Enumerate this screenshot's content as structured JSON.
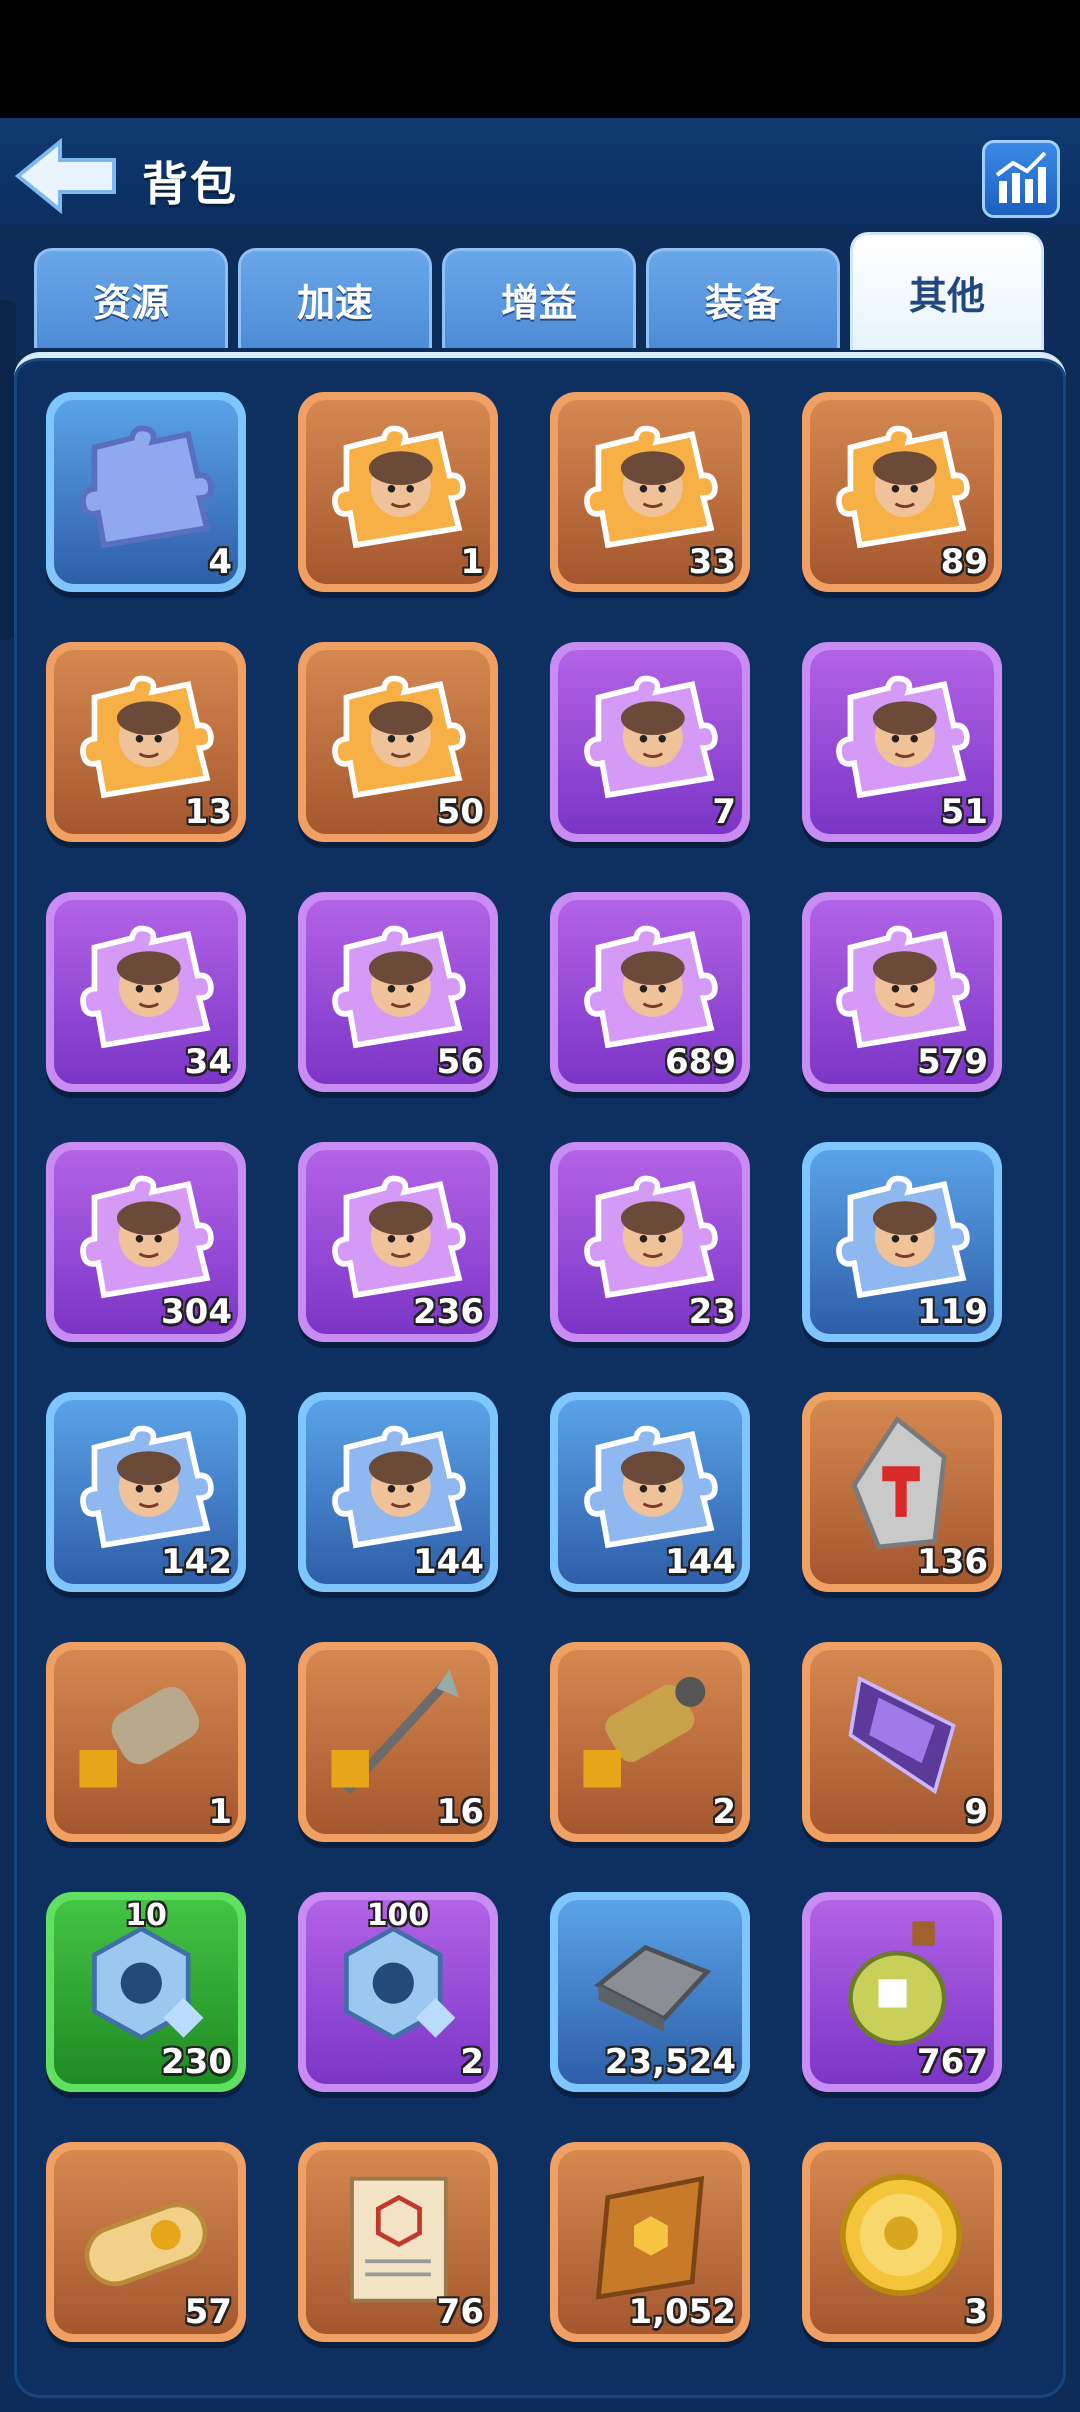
{
  "header": {
    "title": "背包"
  },
  "tabs": [
    {
      "label": "资源",
      "active": false
    },
    {
      "label": "加速",
      "active": false
    },
    {
      "label": "增益",
      "active": false
    },
    {
      "label": "装备",
      "active": false
    },
    {
      "label": "其他",
      "active": true
    }
  ],
  "items": [
    {
      "icon": "blank-puzzle-piece-icon",
      "rarity": "blue",
      "count": "4"
    },
    {
      "icon": "hero-puzzle-hooded-icon",
      "rarity": "orange",
      "count": "1"
    },
    {
      "icon": "hero-puzzle-knight-icon",
      "rarity": "orange",
      "count": "33"
    },
    {
      "icon": "hero-puzzle-bearded-elder-icon",
      "rarity": "orange",
      "count": "89"
    },
    {
      "icon": "hero-puzzle-plague-doctor-icon",
      "rarity": "orange",
      "count": "13"
    },
    {
      "icon": "hero-puzzle-goggles-girl-icon",
      "rarity": "orange",
      "count": "50"
    },
    {
      "icon": "hero-puzzle-headlamp-miner-icon",
      "rarity": "purple",
      "count": "7"
    },
    {
      "icon": "hero-puzzle-bandolier-icon",
      "rarity": "purple",
      "count": "51"
    },
    {
      "icon": "hero-puzzle-dark-haired-woman-icon",
      "rarity": "purple",
      "count": "34"
    },
    {
      "icon": "hero-puzzle-red-haired-woman-icon",
      "rarity": "purple",
      "count": "56"
    },
    {
      "icon": "hero-puzzle-bearded-chief-icon",
      "rarity": "purple",
      "count": "689"
    },
    {
      "icon": "hero-puzzle-aviator-icon",
      "rarity": "purple",
      "count": "579"
    },
    {
      "icon": "hero-puzzle-red-hat-dwarf-icon",
      "rarity": "purple",
      "count": "304"
    },
    {
      "icon": "hero-puzzle-officer-icon",
      "rarity": "purple",
      "count": "236"
    },
    {
      "icon": "hero-puzzle-grey-haired-woman-icon",
      "rarity": "purple",
      "count": "23"
    },
    {
      "icon": "hero-puzzle-blonde-hero-icon",
      "rarity": "blue",
      "count": "119"
    },
    {
      "icon": "hero-puzzle-cap-mustache-icon",
      "rarity": "blue",
      "count": "142"
    },
    {
      "icon": "hero-puzzle-goggles-dwarf-icon",
      "rarity": "blue",
      "count": "144"
    },
    {
      "icon": "hero-puzzle-soldier-icon",
      "rarity": "blue",
      "count": "144"
    },
    {
      "icon": "forge-stone-icon",
      "rarity": "orange",
      "count": "136"
    },
    {
      "icon": "gauntlet-puzzle-icon",
      "rarity": "orange",
      "count": "1"
    },
    {
      "icon": "spear-puzzle-icon",
      "rarity": "orange",
      "count": "16"
    },
    {
      "icon": "cannon-puzzle-icon",
      "rarity": "orange",
      "count": "2"
    },
    {
      "icon": "purple-crystal-icon",
      "rarity": "orange",
      "count": "9"
    },
    {
      "icon": "hex-nut-icon",
      "rarity": "green",
      "count": "230",
      "top_label": "10"
    },
    {
      "icon": "hex-nut-icon",
      "rarity": "purple",
      "count": "2",
      "top_label": "100"
    },
    {
      "icon": "iron-ingot-icon",
      "rarity": "blue",
      "count": "23,524"
    },
    {
      "icon": "potion-bottle-icon",
      "rarity": "purple",
      "count": "767"
    },
    {
      "icon": "scroll-icon",
      "rarity": "orange",
      "count": "57"
    },
    {
      "icon": "blueprint-paper-icon",
      "rarity": "orange",
      "count": "76"
    },
    {
      "icon": "gem-book-icon",
      "rarity": "orange",
      "count": "1,052"
    },
    {
      "icon": "gold-coin-icon",
      "rarity": "orange",
      "count": "3"
    }
  ]
}
